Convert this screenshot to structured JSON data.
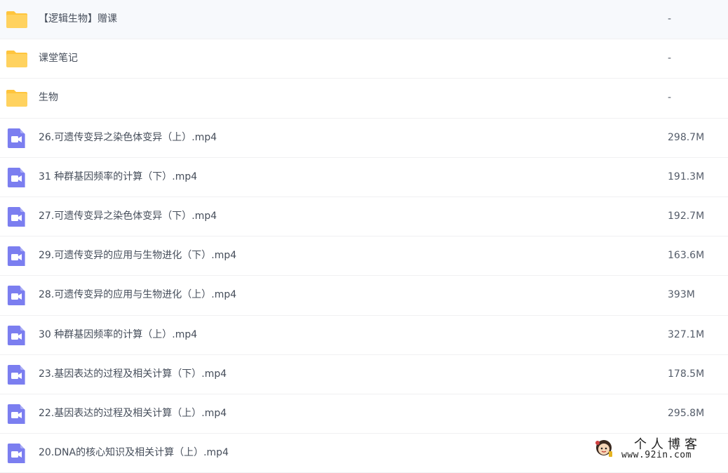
{
  "colors": {
    "folder": "#ffd25f",
    "folder_tab": "#ffc53d",
    "video": "#7b7ef0",
    "text": "#454d5a",
    "divider": "#f0f0f2"
  },
  "files": [
    {
      "type": "folder",
      "icon": "folder-icon",
      "name": "【逻辑生物】赠课",
      "size": "-"
    },
    {
      "type": "folder",
      "icon": "folder-icon",
      "name": "课堂笔记",
      "size": "-"
    },
    {
      "type": "folder",
      "icon": "folder-icon",
      "name": "生物",
      "size": "-"
    },
    {
      "type": "video",
      "icon": "video-file-icon",
      "name": "26.可遗传变异之染色体变异（上）.mp4",
      "size": "298.7M"
    },
    {
      "type": "video",
      "icon": "video-file-icon",
      "name": "31 种群基因频率的计算（下）.mp4",
      "size": "191.3M"
    },
    {
      "type": "video",
      "icon": "video-file-icon",
      "name": "27.可遗传变异之染色体变异（下）.mp4",
      "size": "192.7M"
    },
    {
      "type": "video",
      "icon": "video-file-icon",
      "name": "29.可遗传变异的应用与生物进化（下）.mp4",
      "size": "163.6M"
    },
    {
      "type": "video",
      "icon": "video-file-icon",
      "name": "28.可遗传变异的应用与生物进化（上）.mp4",
      "size": "393M"
    },
    {
      "type": "video",
      "icon": "video-file-icon",
      "name": "30 种群基因频率的计算（上）.mp4",
      "size": "327.1M"
    },
    {
      "type": "video",
      "icon": "video-file-icon",
      "name": "23.基因表达的过程及相关计算（下）.mp4",
      "size": "178.5M"
    },
    {
      "type": "video",
      "icon": "video-file-icon",
      "name": "22.基因表达的过程及相关计算（上）.mp4",
      "size": "295.8M"
    },
    {
      "type": "video",
      "icon": "video-file-icon",
      "name": "20.DNA的核心知识及相关计算（上）.mp4",
      "size": ""
    }
  ],
  "watermark": {
    "title": "个人博客",
    "url": "www.92in.com"
  }
}
